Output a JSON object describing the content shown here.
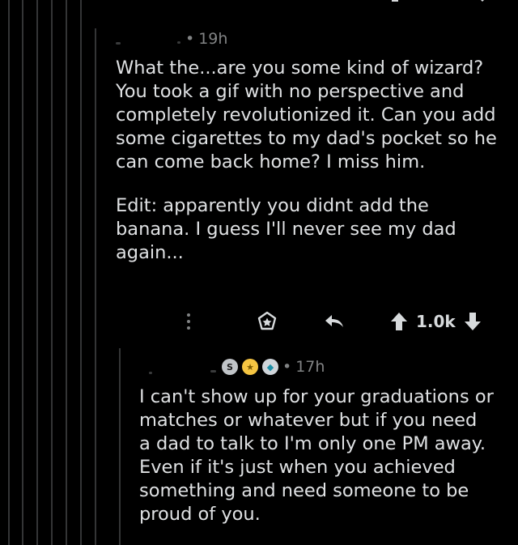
{
  "colors": {
    "background": "#000000",
    "text": "#dfe1e3",
    "meta": "#818384",
    "thread_line": "#343536"
  },
  "top_comment": {
    "timestamp": "19h",
    "separator": "•",
    "paragraphs": [
      "What the...are you some kind of wizard?\nYou took a gif with no perspective and\ncompletely revolutionized it. Can you add\nsome cigarettes to my dad's pocket so he\ncan come back home? I miss him.",
      "Edit: apparently you didnt add the\nbanana. I guess I'll never see my dad\nagain..."
    ],
    "actions": {
      "more": "more-vertical-icon",
      "award": "award-icon",
      "reply": "reply-icon",
      "upvote": "upvote-icon",
      "score": "1.0k",
      "downvote": "downvote-icon"
    }
  },
  "reply_comment": {
    "timestamp": "17h",
    "separator": "•",
    "awards": [
      {
        "icon": "silver-award-icon",
        "glyph": "S",
        "color": "#c0c4c8"
      },
      {
        "icon": "gold-award-icon",
        "glyph": "★",
        "color": "#f5c542"
      },
      {
        "icon": "platinum-award-icon",
        "glyph": "◆",
        "color": "#6fd3e8"
      }
    ],
    "paragraphs": [
      "I can't show up for your graduations or\nmatches or whatever but if you need\na dad to talk to I'm only one PM away.\nEven if it's just when you achieved\nsomething and need someone to be\nproud of you."
    ]
  }
}
